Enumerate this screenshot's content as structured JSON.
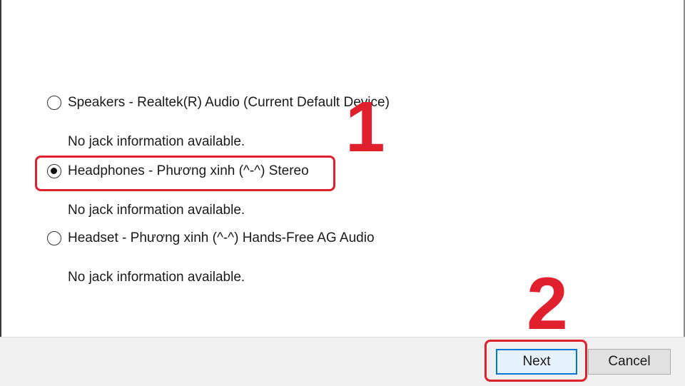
{
  "options": [
    {
      "label": "Speakers - Realtek(R) Audio (Current Default Device)",
      "selected": false,
      "jack_info": "No jack information available."
    },
    {
      "label": "Headphones - Phương xinh (^-^) Stereo",
      "selected": true,
      "jack_info": "No jack information available."
    },
    {
      "label": "Headset - Phương xinh (^-^) Hands-Free AG Audio",
      "selected": false,
      "jack_info": "No jack information available."
    }
  ],
  "annotations": {
    "step1": "1",
    "step2": "2",
    "color": "#e0202c"
  },
  "buttons": {
    "next_label": "Next",
    "cancel_label": "Cancel"
  }
}
